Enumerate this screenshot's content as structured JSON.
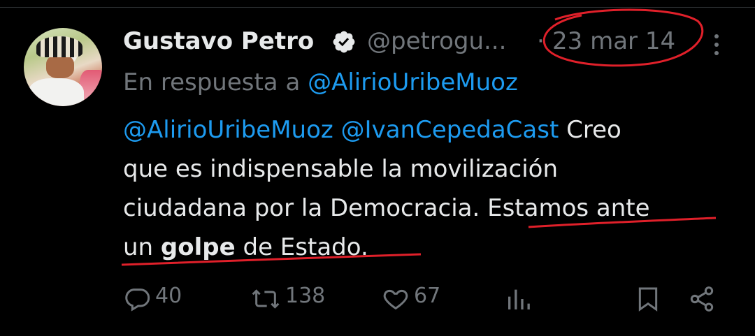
{
  "tweet": {
    "author_name": "Gustavo Petro",
    "handle": "@petrogu...",
    "separator": "·",
    "date": "23 mar 14",
    "reply_prefix": "En respuesta a",
    "reply_mention": "@AlirioUribeMuoz",
    "body": {
      "line1_mention1": "@AlirioUribeMuoz",
      "line1_mention2": "@IvanCepedaCast",
      "line1_text": "Creo",
      "line2": "que es indispensable la movilización",
      "line3_text": "ciudadana por la Democracia.",
      "line3_underlined": "Estamos ante",
      "line4_prefix": "un",
      "line4_bold": "golpe",
      "line4_suffix": "de Estado."
    },
    "actions": {
      "replies": "40",
      "retweets": "138",
      "likes": "67"
    }
  },
  "colors": {
    "background": "#000000",
    "text_primary": "#e7e9ea",
    "text_secondary": "#71767b",
    "link": "#1d9bf0",
    "verified": "#e7e9ea",
    "annotation": "#e0202a"
  },
  "icons": [
    "verified-badge-icon",
    "more-icon",
    "reply-icon",
    "retweet-icon",
    "like-icon",
    "views-icon",
    "bookmark-icon",
    "share-icon"
  ]
}
